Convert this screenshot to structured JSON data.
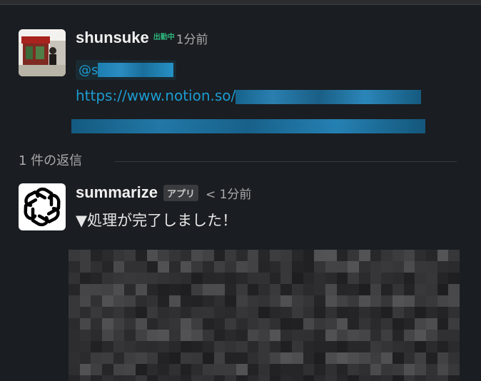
{
  "thread": {
    "parent": {
      "author": "shunsuke",
      "status_emoji": "出勤中",
      "time": "1分前",
      "mention": "@s",
      "link_line1": "https://www.notion.so/",
      "link_line2": ""
    },
    "replies_label": "1 件の返信",
    "reply": {
      "author": "summarize",
      "app_badge": "アプリ",
      "time": "< 1分前",
      "text": "▼処理が完了しました！"
    }
  },
  "colors": {
    "background": "#1a1d21",
    "link": "#1d9bd1",
    "status_green": "#2eb67d",
    "muted_text": "#a9aaab"
  },
  "icons": {
    "app_avatar": "openai-logo-icon",
    "user_avatar": "user-photo"
  }
}
